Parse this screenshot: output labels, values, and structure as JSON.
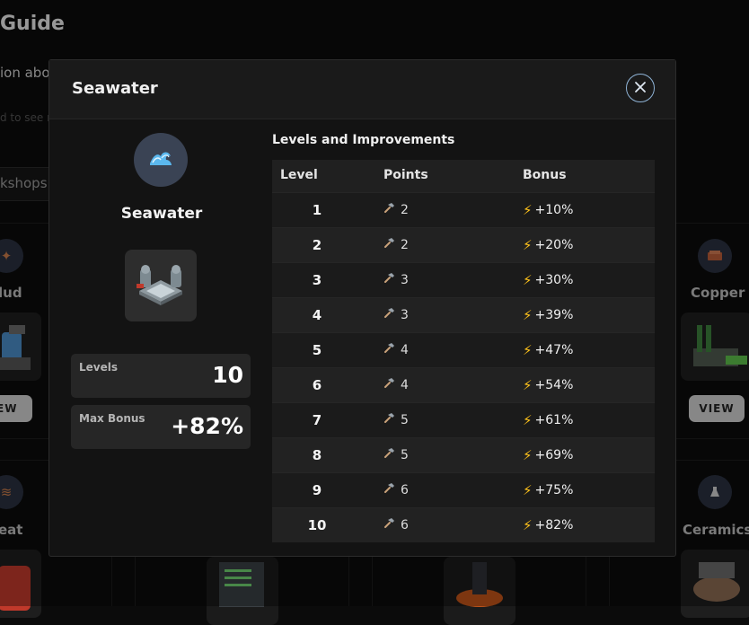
{
  "background": {
    "title_fragment": "Guide",
    "subtitle_fragment": "ion abo",
    "hint_fragment": "d to see r",
    "search_fragment": "kshops",
    "items": [
      {
        "name": "lud",
        "view_label": "IEW"
      },
      {
        "name": "Copper",
        "view_label": "VIEW"
      },
      {
        "name": "eat"
      },
      {
        "name": "Ceramics"
      }
    ]
  },
  "modal": {
    "title": "Seawater",
    "item_name": "Seawater",
    "item_icon": "wave-icon",
    "levels_label": "Levels",
    "levels_value": "10",
    "max_bonus_label": "Max Bonus",
    "max_bonus_value": "+82%",
    "section_title": "Levels and Improvements",
    "table": {
      "headers": [
        "Level",
        "Points",
        "Bonus"
      ],
      "rows": [
        {
          "level": "1",
          "points": "2",
          "bonus": "+10%"
        },
        {
          "level": "2",
          "points": "2",
          "bonus": "+20%"
        },
        {
          "level": "3",
          "points": "3",
          "bonus": "+30%"
        },
        {
          "level": "4",
          "points": "3",
          "bonus": "+39%"
        },
        {
          "level": "5",
          "points": "4",
          "bonus": "+47%"
        },
        {
          "level": "6",
          "points": "4",
          "bonus": "+54%"
        },
        {
          "level": "7",
          "points": "5",
          "bonus": "+61%"
        },
        {
          "level": "8",
          "points": "5",
          "bonus": "+69%"
        },
        {
          "level": "9",
          "points": "6",
          "bonus": "+75%"
        },
        {
          "level": "10",
          "points": "6",
          "bonus": "+82%"
        }
      ]
    }
  },
  "colors": {
    "accent_bolt": "#ffc21a",
    "close_ring": "#8fb3d6",
    "modal_bg": "#131313"
  }
}
